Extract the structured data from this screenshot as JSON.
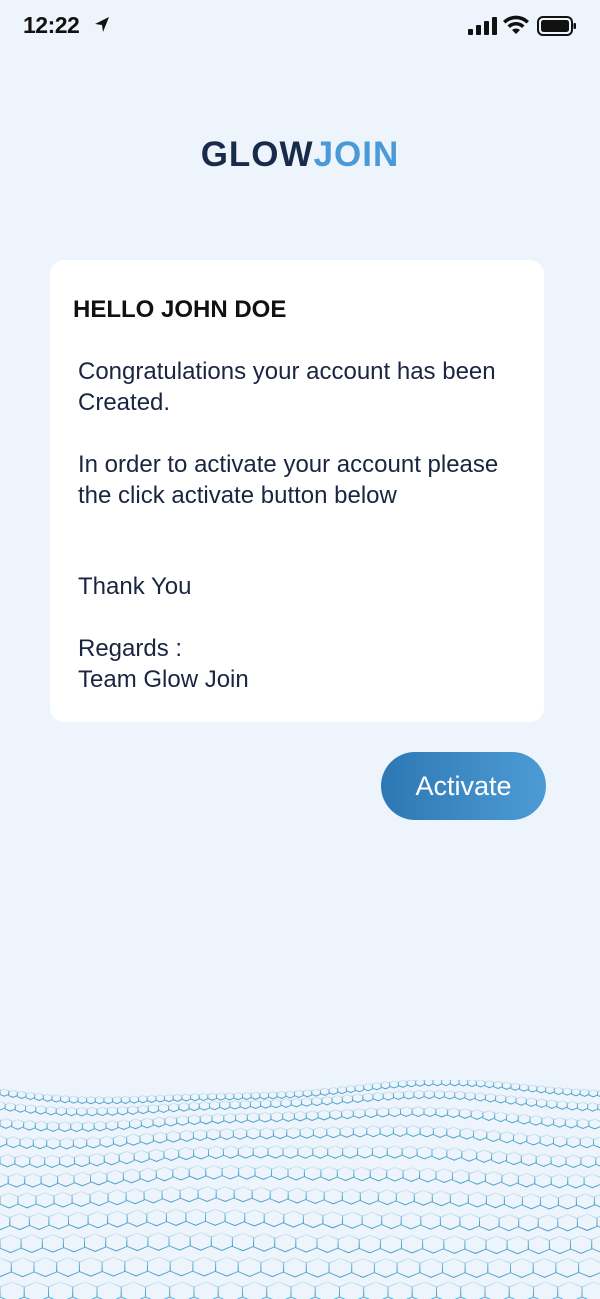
{
  "status_bar": {
    "time": "12:22"
  },
  "logo": {
    "part_a": "GLOW",
    "part_b": "JOIN"
  },
  "message": {
    "greeting": "HELLO JOHN DOE",
    "paragraph_1": "Congratulations your account has been Created.",
    "paragraph_2": "In order to activate your account please the  click activate button below",
    "paragraph_3": "Thank You",
    "paragraph_4_line_1": "Regards :",
    "paragraph_4_line_2": "Team Glow Join"
  },
  "actions": {
    "activate_label": "Activate"
  },
  "colors": {
    "background": "#eef4fb",
    "logo_dark": "#1a2a4a",
    "logo_accent": "#4a9ad8",
    "button_start": "#2d78b4",
    "button_end": "#4d9bd4"
  }
}
